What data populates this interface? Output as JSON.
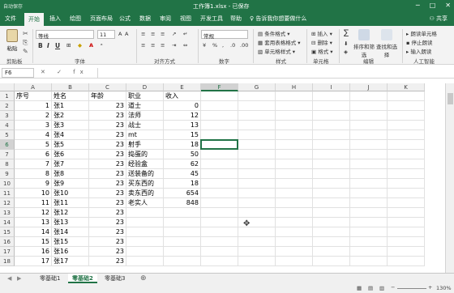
{
  "titlebar": {
    "autosave": "自动保存",
    "title": "工作簿1.xlsx - 已保存",
    "min": "─",
    "max": "□",
    "close": "✕"
  },
  "tabs": [
    "文件",
    "开始",
    "插入",
    "绘图",
    "页面布局",
    "公式",
    "数据",
    "审阅",
    "视图",
    "开发工具",
    "帮助"
  ],
  "active_tab_index": 1,
  "tellme": "告诉我你想要做什么",
  "share": "共享",
  "ribbon": {
    "paste": "粘贴",
    "clipboard": "剪贴板",
    "font_name": "等线",
    "font_size": "11",
    "font_group": "字体",
    "align_group": "对齐方式",
    "number_format": "常规",
    "number_group": "数字",
    "cond_format": "条件格式",
    "table_format": "套用表格格式",
    "cell_style": "单元格样式",
    "styles_group": "样式",
    "insert": "插入",
    "delete": "删除",
    "format": "格式",
    "cells_group": "单元格",
    "sum": "∑",
    "sort_filter": "排序和筛选",
    "find_select": "查找和选择",
    "editing_group": "编辑",
    "read_cells": "朗读单元格",
    "stop_read": "停止朗读",
    "read_input": "输入朗读",
    "ai_group": "人工智能",
    "bold": "B",
    "italic": "I",
    "underline": "U"
  },
  "formula": {
    "namebox": "F6",
    "fx": "✕ ✓ fx",
    "value": ""
  },
  "columns": [
    "A",
    "B",
    "C",
    "D",
    "E",
    "F",
    "G",
    "H",
    "I",
    "J",
    "K"
  ],
  "selected_col": "F",
  "selected_row": 6,
  "rows": [
    [
      "序号",
      "姓名",
      "年龄",
      "职业",
      "收入"
    ],
    [
      "1",
      "张1",
      "23",
      "道士",
      "0"
    ],
    [
      "2",
      "张2",
      "23",
      "法师",
      "12"
    ],
    [
      "3",
      "张3",
      "23",
      "战士",
      "13"
    ],
    [
      "4",
      "张4",
      "23",
      "mt",
      "15"
    ],
    [
      "5",
      "张5",
      "23",
      "射手",
      "18"
    ],
    [
      "6",
      "张6",
      "23",
      "捣蛋的",
      "50"
    ],
    [
      "7",
      "张7",
      "23",
      "经验盒",
      "62"
    ],
    [
      "8",
      "张8",
      "23",
      "送装备的",
      "45"
    ],
    [
      "9",
      "张9",
      "23",
      "买东西的",
      "18"
    ],
    [
      "10",
      "张10",
      "23",
      "卖东西的",
      "654"
    ],
    [
      "11",
      "张11",
      "23",
      "老实人",
      "848"
    ],
    [
      "12",
      "张12",
      "23",
      "",
      ""
    ],
    [
      "13",
      "张13",
      "23",
      "",
      ""
    ],
    [
      "14",
      "张14",
      "23",
      "",
      ""
    ],
    [
      "15",
      "张15",
      "23",
      "",
      ""
    ],
    [
      "16",
      "张16",
      "23",
      "",
      ""
    ],
    [
      "17",
      "张17",
      "23",
      "",
      ""
    ]
  ],
  "sheets": [
    "零基础1",
    "零基础2",
    "零基础3"
  ],
  "active_sheet_index": 1,
  "add_sheet": "⊕",
  "zoom": "130%",
  "colors": {
    "accent": "#217346"
  }
}
